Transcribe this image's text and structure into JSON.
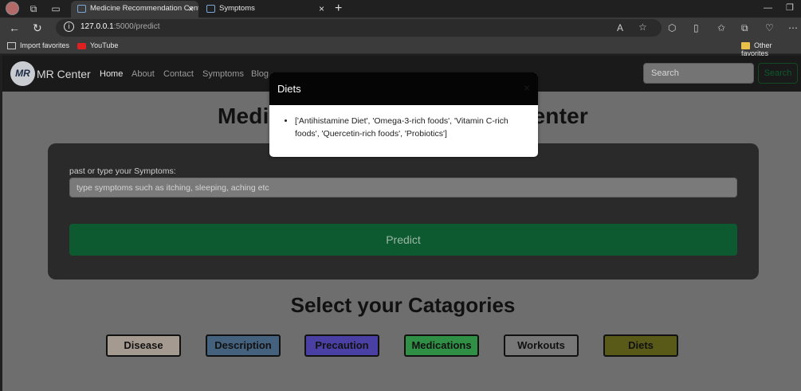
{
  "browser": {
    "tabs": [
      {
        "title": "Medicine Recommendation Cent",
        "active": true
      },
      {
        "title": "Symptoms",
        "active": false
      }
    ],
    "url_host": "127.0.0.1",
    "url_path": ":5000/predict",
    "favorites": {
      "import_label": "Import favorites",
      "youtube_label": "YouTube",
      "other_label": "Other favorites"
    }
  },
  "navbar": {
    "logo_text": "MR",
    "brand": "MR Center",
    "links": [
      "Home",
      "About",
      "Contact",
      "Symptoms",
      "Blog"
    ],
    "search_placeholder": "Search",
    "search_button": "Search"
  },
  "main": {
    "title": "Medicine Recommendation Center",
    "input_label": "past or type your Symptoms:",
    "input_placeholder": "type symptoms such as itching, sleeping, aching etc",
    "predict_label": "Predict"
  },
  "categories": {
    "title": "Select your Catagories",
    "buttons": [
      {
        "label": "Disease",
        "color": "#a59a90"
      },
      {
        "label": "Description",
        "color": "#44617e"
      },
      {
        "label": "Precaution",
        "color": "#4a40a4"
      },
      {
        "label": "Medications",
        "color": "#2f8f44"
      },
      {
        "label": "Workouts",
        "color": "#777777"
      },
      {
        "label": "Diets",
        "color": "#5a5a18"
      }
    ]
  },
  "modal": {
    "title": "Diets",
    "close": "×",
    "items": [
      "['Antihistamine Diet', 'Omega-3-rich foods', 'Vitamin C-rich foods', 'Quercetin-rich foods', 'Probiotics']"
    ]
  }
}
